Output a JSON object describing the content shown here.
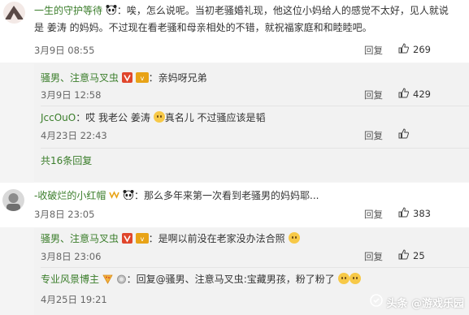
{
  "comments": [
    {
      "username": "一生的守护等待",
      "text_line1": "：唉，怎么说呢。当初老骚婚礼现，他这位小妈给人的感觉不太好，见人就说",
      "text_line2": "是 姜涛 的妈妈。不过现在看老骚和母亲相处的不错，就祝福家庭和和睦睦吧。",
      "date": "3月9日 08:55",
      "reply_label": "回复",
      "likes": "269",
      "replies": [
        {
          "username": "骚男、注意马叉虫",
          "text": "：亲妈呀兄弟",
          "date": "3月9日 12:58",
          "reply_label": "回复",
          "likes": "429"
        },
        {
          "username": "JccOuO",
          "text_a": "：哎 我老公 姜涛",
          "text_b": "真名儿 不过骚应该是韬",
          "date": "4月23日 22:43",
          "reply_label": "回复",
          "likes": ""
        }
      ],
      "more_replies": "共16条回复"
    },
    {
      "username": "-收破烂的小红帽",
      "text": "：那么多年来第一次看到老骚男的妈妈耶...",
      "date": "3月8日 23:05",
      "reply_label": "回复",
      "likes": "383",
      "replies": [
        {
          "username": "骚男、注意马叉虫",
          "text": "：是啊以前没在老家没办法合照",
          "date": "3月8日 23:06",
          "reply_label": "回复",
          "likes": "25"
        },
        {
          "username": "专业风景博主",
          "text_a": "：回复@骚男、注意马叉虫",
          "text_b": ":宝藏男孩，粉了粉了",
          "date": "4月25日 19:21",
          "reply_label": "",
          "likes": ""
        }
      ]
    }
  ],
  "watermark": "头条 @游戏乐园",
  "colors": {
    "username": "#3a7d2a",
    "vip_badge": "#e8a317",
    "v_badge": "#e0462c"
  }
}
